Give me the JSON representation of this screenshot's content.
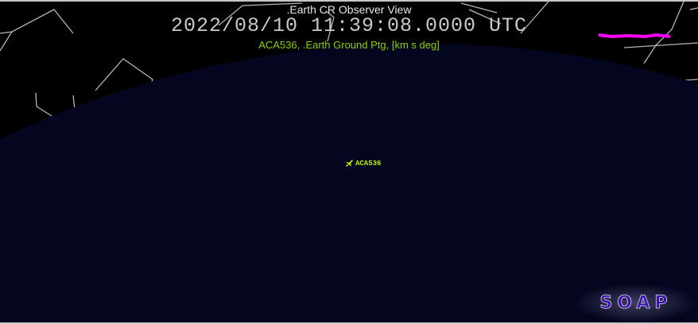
{
  "view": {
    "title": ".Earth CR Observer View",
    "timestamp": "2022/08/10 11:39:08.0000 UTC",
    "subtitle": "ACA536, .Earth Ground Ptg,  [km s deg]",
    "aircraft_label": "ACA536",
    "logo": "SOAP"
  },
  "colors": {
    "earth": "#04061f",
    "constellation": "#b4b4b4",
    "subtitle": "#8ccf00",
    "marker": "#b6f000",
    "trail": "#ff00ff"
  }
}
